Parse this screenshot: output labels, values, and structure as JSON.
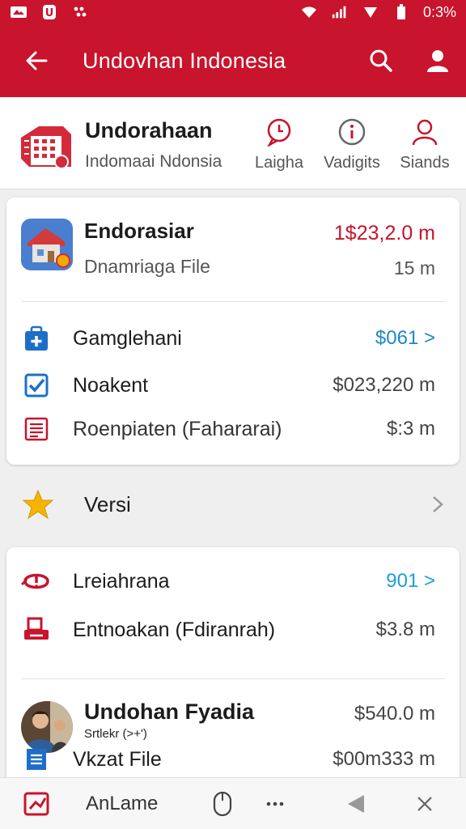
{
  "status": {
    "time": "0:3%"
  },
  "appbar": {
    "title": "Undovhan Indonesia"
  },
  "header": {
    "title": "Undorahaan",
    "subtitle": "Indomaai Ndonsia",
    "actions": [
      {
        "label": "Laigha",
        "icon": "chat-bubble-icon"
      },
      {
        "label": "Vadigits",
        "icon": "info-icon"
      },
      {
        "label": "Siands",
        "icon": "person-outline-icon"
      }
    ]
  },
  "card1": {
    "title": "Endorasiar",
    "subtitle": "Dnamriaga File",
    "amount": "1$23,2.0 m",
    "size": "15 m",
    "rows": [
      {
        "label": "Gamglehani",
        "value": "$061 >"
      },
      {
        "label": "Noakent",
        "value": "$023,220 m"
      },
      {
        "label": "Roenpiaten (Fahararai)",
        "value": "$:3 m"
      }
    ]
  },
  "versi": {
    "label": "Versi"
  },
  "card2": {
    "rows": [
      {
        "label": "Lreiahrana",
        "value": "901 >"
      },
      {
        "label": "Entnoakan (Fdiranrah)",
        "value": "$3.8 m"
      }
    ],
    "person": {
      "name": "Undohan Fyadia",
      "handle": "Srtlekr (>+')",
      "amount": "$540.0 m"
    },
    "file": {
      "label": "Vkzat File",
      "value": "$00m333 m"
    }
  },
  "bottom": {
    "label": "AnLame"
  },
  "colors": {
    "primary": "#c8142c",
    "link": "#1e88c8",
    "star": "#f4b400"
  }
}
